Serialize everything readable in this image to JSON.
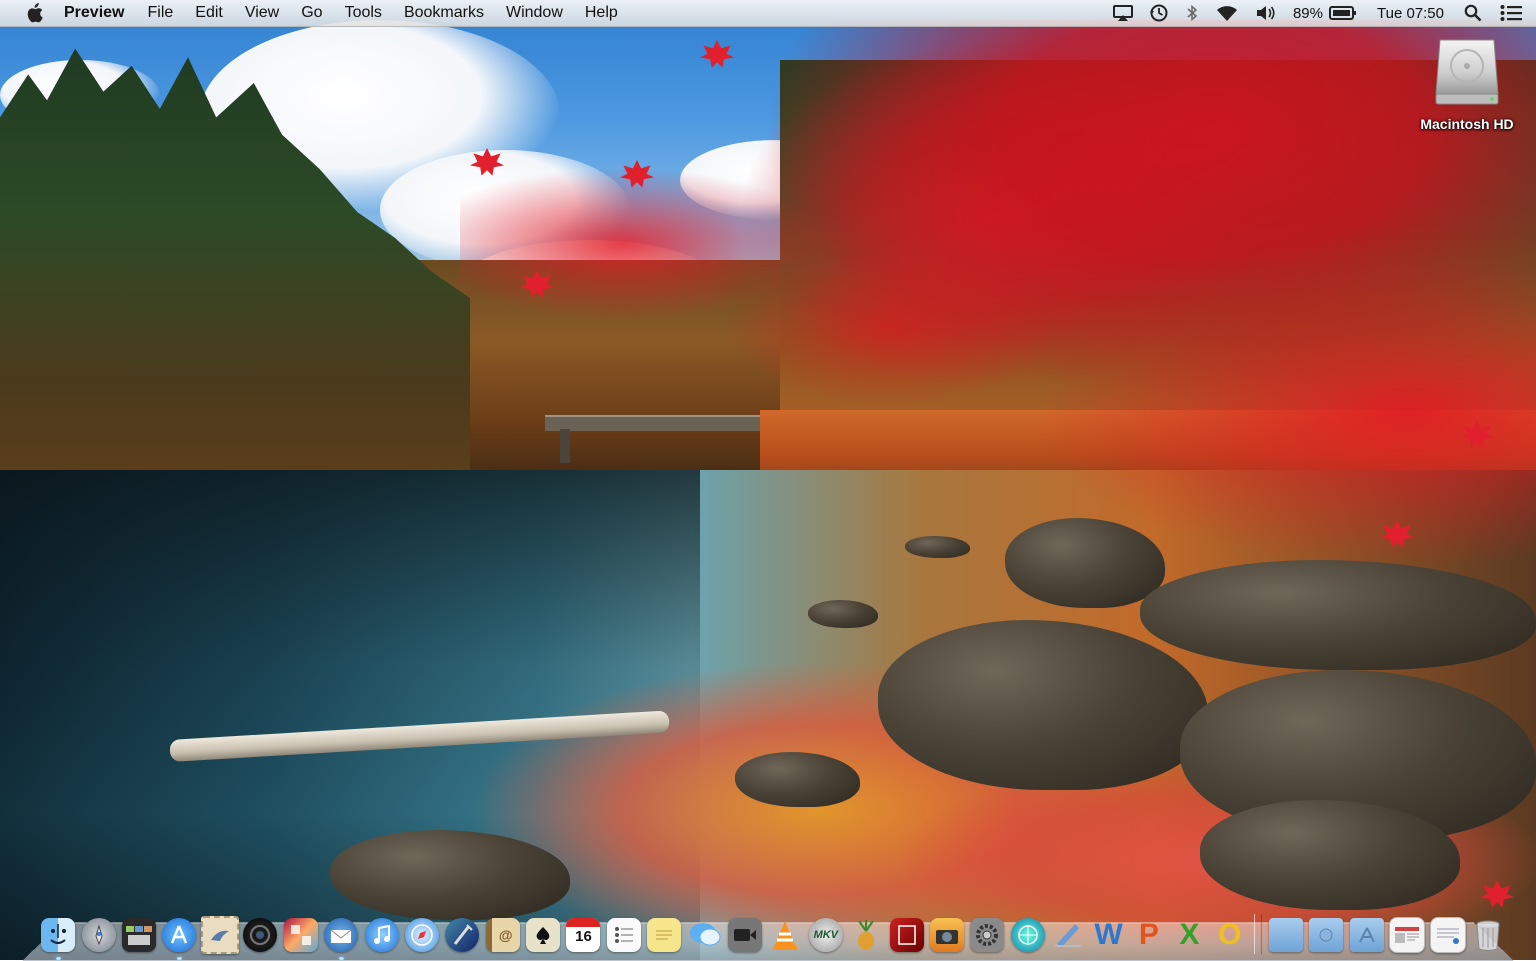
{
  "menubar": {
    "apple_icon": "apple-logo",
    "app_name": "Preview",
    "menus": [
      "File",
      "Edit",
      "View",
      "Go",
      "Tools",
      "Bookmarks",
      "Window",
      "Help"
    ],
    "status": {
      "airplay_icon": "airplay-icon",
      "time_machine_icon": "time-machine-icon",
      "bluetooth_icon": "bluetooth-icon",
      "wifi_icon": "wifi-icon",
      "volume_icon": "volume-icon",
      "battery_percent": "89%",
      "battery_icon": "battery-icon",
      "clock": "Tue 07:50",
      "spotlight_icon": "spotlight-search-icon",
      "notification_icon": "notification-center-icon"
    }
  },
  "desktop": {
    "drive_label": "Macintosh HD",
    "wallpaper": "autumn-lake-wallpaper"
  },
  "dock": {
    "calendar_day": "16",
    "mkv_label": "MKV",
    "items": [
      "finder",
      "launchpad",
      "mission-control",
      "app-store",
      "mail-stamp",
      "facetime",
      "photo-booth",
      "thunderbird",
      "itunes",
      "safari",
      "xcode",
      "address-book",
      "solitaire",
      "calendar",
      "reminders",
      "notes",
      "messages",
      "video-capture",
      "vlc",
      "mkv-tool",
      "fruit-app",
      "photo-browser",
      "iphoto",
      "system-preferences",
      "network-utility",
      "pen-tool",
      "word",
      "powerpoint",
      "excel",
      "outlook"
    ],
    "right_items": [
      "applications-folder",
      "documents-folder",
      "downloads-folder",
      "web-preview",
      "mail-preview",
      "trash"
    ],
    "office_letters": {
      "word": "W",
      "powerpoint": "P",
      "excel": "X",
      "outlook": "O"
    }
  }
}
